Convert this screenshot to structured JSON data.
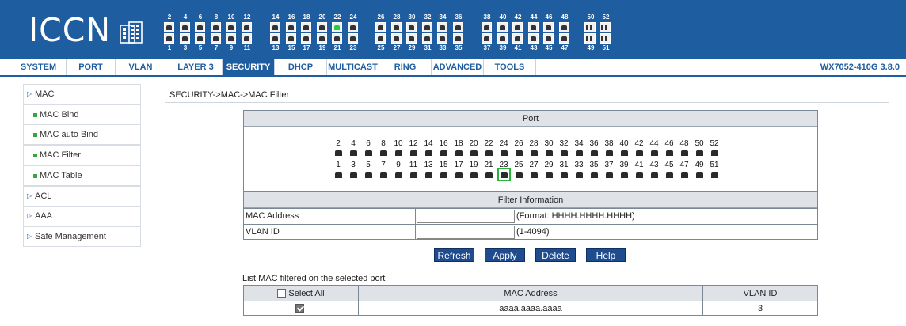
{
  "brand": {
    "logo_text": "ICCN"
  },
  "header_ports": {
    "even_labels": [
      "2",
      "4",
      "6",
      "8",
      "10",
      "12",
      "14",
      "16",
      "18",
      "20",
      "22",
      "24",
      "26",
      "28",
      "30",
      "32",
      "34",
      "36",
      "38",
      "40",
      "42",
      "44",
      "46",
      "48"
    ],
    "odd_labels": [
      "1",
      "3",
      "5",
      "7",
      "9",
      "11",
      "13",
      "15",
      "17",
      "19",
      "21",
      "23",
      "25",
      "27",
      "29",
      "31",
      "33",
      "35",
      "37",
      "39",
      "41",
      "43",
      "45",
      "47"
    ],
    "sfp_even_labels": [
      "50",
      "52"
    ],
    "sfp_odd_labels": [
      "49",
      "51"
    ],
    "active_even": [
      "22"
    ]
  },
  "menu": [
    {
      "label": "SYSTEM"
    },
    {
      "label": "PORT"
    },
    {
      "label": "VLAN"
    },
    {
      "label": "LAYER 3"
    },
    {
      "label": "SECURITY",
      "selected": true
    },
    {
      "label": "DHCP"
    },
    {
      "label": "MULTICAST"
    },
    {
      "label": "RING"
    },
    {
      "label": "ADVANCED"
    },
    {
      "label": "TOOLS"
    }
  ],
  "version": "WX7052-410G 3.8.0",
  "sidebar": [
    {
      "label": "MAC",
      "type": "group"
    },
    {
      "label": "MAC Bind",
      "type": "sub"
    },
    {
      "label": "MAC auto Bind",
      "type": "sub"
    },
    {
      "label": "MAC Filter",
      "type": "sub"
    },
    {
      "label": "MAC Table",
      "type": "sub"
    },
    {
      "label": "ACL",
      "type": "group"
    },
    {
      "label": "AAA",
      "type": "group"
    },
    {
      "label": "Safe Management",
      "type": "group"
    }
  ],
  "breadcrumb": "SECURITY->MAC->MAC Filter",
  "port_panel": {
    "title": "Port",
    "top_labels": [
      "2",
      "4",
      "6",
      "8",
      "10",
      "12",
      "14",
      "16",
      "18",
      "20",
      "22",
      "24",
      "26",
      "28",
      "30",
      "32",
      "34",
      "36",
      "38",
      "40",
      "42",
      "44",
      "46",
      "48",
      "50",
      "52"
    ],
    "bottom_labels": [
      "1",
      "3",
      "5",
      "7",
      "9",
      "11",
      "13",
      "15",
      "17",
      "19",
      "21",
      "23",
      "25",
      "27",
      "29",
      "31",
      "33",
      "35",
      "37",
      "39",
      "41",
      "43",
      "45",
      "47",
      "49",
      "51"
    ],
    "selected_port": "23"
  },
  "filter": {
    "title": "Filter Information",
    "mac_label": "MAC Address",
    "mac_value": "",
    "mac_hint": "(Format: HHHH.HHHH.HHHH)",
    "vlan_label": "VLAN ID",
    "vlan_value": "",
    "vlan_hint": "(1-4094)"
  },
  "buttons": {
    "refresh": "Refresh",
    "apply": "Apply",
    "delete": "Delete",
    "help": "Help"
  },
  "list": {
    "caption": "List MAC filtered on the selected port",
    "select_all_label": "Select All",
    "col_mac": "MAC Address",
    "col_vlan": "VLAN ID",
    "rows": [
      {
        "checked": true,
        "mac": "aaaa.aaaa.aaaa",
        "vlan": "3"
      }
    ]
  },
  "colors": {
    "header_bg": "#1e5ea0",
    "menu_selected_bg": "#1e5ea0",
    "button_bg": "#1e4c8f",
    "active_port": "#23d03c"
  }
}
